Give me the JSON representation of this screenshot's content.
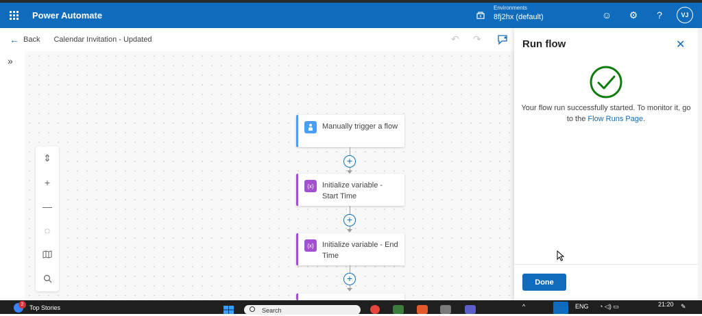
{
  "appbar": {
    "title": "Power Automate",
    "environment_label": "Environments",
    "environment_value": "8fj2hx (default)",
    "avatar_initials": "VJ"
  },
  "cmdbar": {
    "back_label": "Back",
    "flow_name": "Calendar Invitation - Updated"
  },
  "flow": {
    "steps": [
      {
        "label": "Manually trigger a flow",
        "accent": "#4a9ff5",
        "icon": "user-touch-icon",
        "icon_text": ""
      },
      {
        "label": "Initialize variable - Start Time",
        "accent": "#a24fd1",
        "icon": "variable-icon",
        "icon_text": "{x}"
      },
      {
        "label": "Initialize variable - End Time",
        "accent": "#a24fd1",
        "icon": "variable-icon",
        "icon_text": "{x}"
      }
    ]
  },
  "run_panel": {
    "title": "Run flow",
    "message_prefix": "Your flow run successfully started. To monitor it, go to the",
    "link_text": "Flow Runs Page",
    "message_suffix": ".",
    "done_label": "Done"
  },
  "taskbar": {
    "news_label": "Top Stories",
    "news_badge": "2",
    "search_placeholder": "Search",
    "language": "ENG",
    "time": "21:20"
  },
  "colors": {
    "brand": "#0f6cbd",
    "success": "#107c10"
  }
}
